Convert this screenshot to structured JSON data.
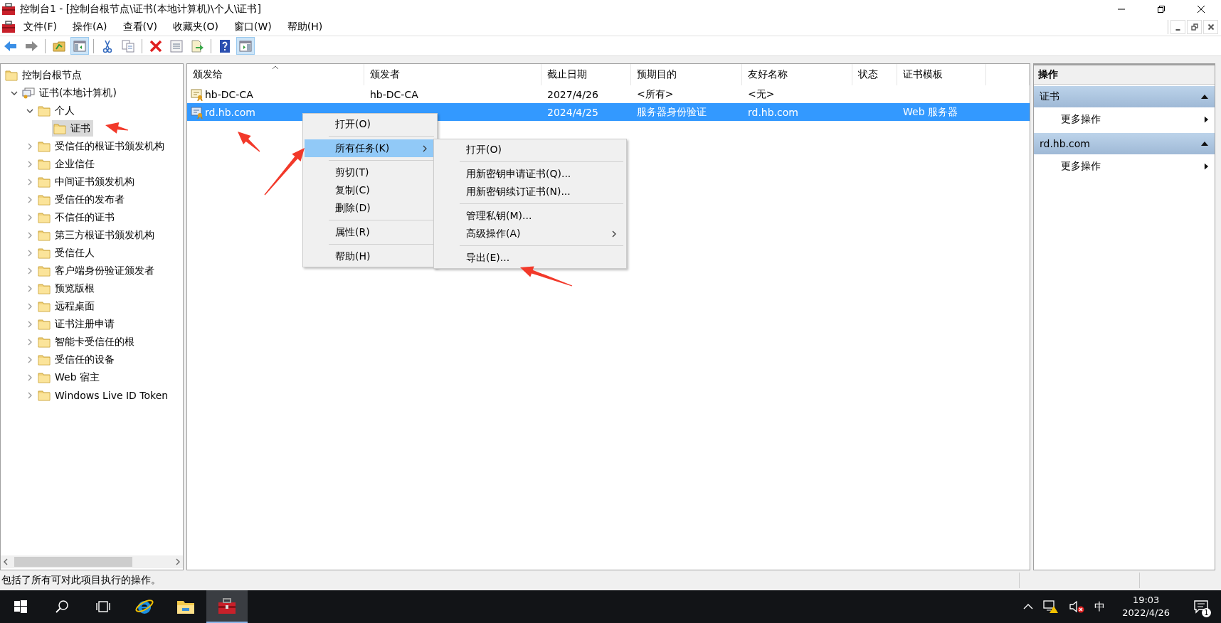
{
  "window": {
    "title": "控制台1 - [控制台根节点\\证书(本地计算机)\\个人\\证书]"
  },
  "menu": [
    "文件(F)",
    "操作(A)",
    "查看(V)",
    "收藏夹(O)",
    "窗口(W)",
    "帮助(H)"
  ],
  "toolbar": [
    {
      "kind": "back",
      "pressed": false
    },
    {
      "kind": "forward",
      "pressed": false
    },
    {
      "kind": "separator"
    },
    {
      "kind": "up",
      "pressed": false
    },
    {
      "kind": "tree",
      "pressed": true
    },
    {
      "kind": "separator"
    },
    {
      "kind": "cut",
      "pressed": false
    },
    {
      "kind": "copy",
      "pressed": false
    },
    {
      "kind": "separator"
    },
    {
      "kind": "delete",
      "pressed": false
    },
    {
      "kind": "properties",
      "pressed": false
    },
    {
      "kind": "export",
      "pressed": false
    },
    {
      "kind": "separator"
    },
    {
      "kind": "help",
      "pressed": false
    },
    {
      "kind": "action_pane",
      "pressed": true
    }
  ],
  "tree": [
    {
      "label": "控制台根节点",
      "kind": "folder",
      "selected": false,
      "children": [
        {
          "label": "证书(本地计算机)",
          "kind": "store",
          "expanded": true,
          "selected": false,
          "children": [
            {
              "label": "个人",
              "kind": "folder",
              "expanded": true,
              "selected": false,
              "children": [
                {
                  "label": "证书",
                  "kind": "folder",
                  "selected": true
                }
              ]
            },
            {
              "label": "受信任的根证书颁发机构",
              "kind": "folder",
              "expanded": false,
              "selected": false
            },
            {
              "label": "企业信任",
              "kind": "folder",
              "expanded": false,
              "selected": false
            },
            {
              "label": "中间证书颁发机构",
              "kind": "folder",
              "expanded": false,
              "selected": false
            },
            {
              "label": "受信任的发布者",
              "kind": "folder",
              "expanded": false,
              "selected": false
            },
            {
              "label": "不信任的证书",
              "kind": "folder",
              "expanded": false,
              "selected": false
            },
            {
              "label": "第三方根证书颁发机构",
              "kind": "folder",
              "expanded": false,
              "selected": false
            },
            {
              "label": "受信任人",
              "kind": "folder",
              "expanded": false,
              "selected": false
            },
            {
              "label": "客户端身份验证颁发者",
              "kind": "folder",
              "expanded": false,
              "selected": false
            },
            {
              "label": "预览版根",
              "kind": "folder",
              "expanded": false,
              "selected": false
            },
            {
              "label": "远程桌面",
              "kind": "folder",
              "expanded": false,
              "selected": false
            },
            {
              "label": "证书注册申请",
              "kind": "folder",
              "expanded": false,
              "selected": false
            },
            {
              "label": "智能卡受信任的根",
              "kind": "folder",
              "expanded": false,
              "selected": false
            },
            {
              "label": "受信任的设备",
              "kind": "folder",
              "expanded": false,
              "selected": false
            },
            {
              "label": "Web 宿主",
              "kind": "folder",
              "expanded": false,
              "selected": false
            },
            {
              "label": "Windows Live ID Token",
              "kind": "folder",
              "expanded": false,
              "selected": false
            }
          ]
        }
      ]
    }
  ],
  "table": {
    "columns": [
      {
        "label": "颁发给",
        "sorted": true
      },
      {
        "label": "颁发者",
        "sorted": false
      },
      {
        "label": "截止日期",
        "sorted": false
      },
      {
        "label": "预期目的",
        "sorted": false
      },
      {
        "label": "友好名称",
        "sorted": false
      },
      {
        "label": "状态",
        "sorted": false
      },
      {
        "label": "证书模板",
        "sorted": false
      }
    ],
    "rows": [
      {
        "kind": "root_cert",
        "selected": false,
        "cells": [
          "hb-DC-CA",
          "hb-DC-CA",
          "2027/4/26",
          "<所有>",
          "<无>",
          null,
          null
        ]
      },
      {
        "kind": "cert",
        "selected": true,
        "cells": [
          "rd.hb.com",
          null,
          "2024/4/25",
          "服务器身份验证",
          "rd.hb.com",
          null,
          "Web 服务器"
        ]
      }
    ]
  },
  "context_menu": {
    "groups": [
      [
        {
          "label": "打开(O)",
          "selected": false,
          "submenu": false
        }
      ],
      [
        {
          "label": "所有任务(K)",
          "selected": true,
          "submenu": true
        }
      ],
      [
        {
          "label": "剪切(T)",
          "selected": false,
          "submenu": false
        },
        {
          "label": "复制(C)",
          "selected": false,
          "submenu": false
        },
        {
          "label": "删除(D)",
          "selected": false,
          "submenu": false
        }
      ],
      [
        {
          "label": "属性(R)",
          "selected": false,
          "submenu": false
        }
      ],
      [
        {
          "label": "帮助(H)",
          "selected": false,
          "submenu": false
        }
      ]
    ]
  },
  "submenu": {
    "groups": [
      [
        {
          "label": "打开(O)",
          "selected": false,
          "submenu": false
        }
      ],
      [
        {
          "label": "用新密钥申请证书(Q)...",
          "selected": false,
          "submenu": false
        },
        {
          "label": "用新密钥续订证书(N)...",
          "selected": false,
          "submenu": false
        }
      ],
      [
        {
          "label": "管理私钥(M)...",
          "selected": false,
          "submenu": false
        },
        {
          "label": "高级操作(A)",
          "selected": false,
          "submenu": true
        }
      ],
      [
        {
          "label": "导出(E)...",
          "selected": false,
          "submenu": false
        }
      ]
    ]
  },
  "actions": {
    "title": "操作",
    "sections": [
      {
        "title": "证书",
        "expanded": true,
        "items": [
          {
            "label": "更多操作",
            "submenu": true
          }
        ]
      },
      {
        "title": "rd.hb.com",
        "expanded": true,
        "items": [
          {
            "label": "更多操作",
            "submenu": true
          }
        ]
      }
    ]
  },
  "status_bar": {
    "text": "包括了所有可对此项目执行的操作。"
  },
  "taskbar": {
    "apps": [
      {
        "kind": "start",
        "active": false
      },
      {
        "kind": "search",
        "active": false
      },
      {
        "kind": "task_view",
        "active": false
      },
      {
        "kind": "ie",
        "active": false
      },
      {
        "kind": "explorer",
        "active": false
      },
      {
        "kind": "mmc",
        "active": true
      }
    ],
    "tray": {
      "ime": "中",
      "time": "19:03",
      "date": "2022/4/26",
      "notifications": "1"
    }
  }
}
